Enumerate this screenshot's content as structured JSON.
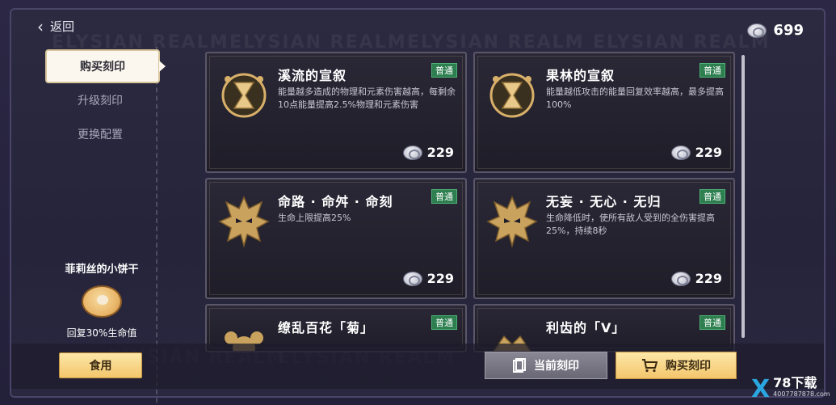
{
  "header": {
    "back_label": "返回",
    "currency_amount": "699",
    "watermark_text": "ELYSIAN REALM"
  },
  "sidebar": {
    "items": [
      {
        "label": "购买刻印",
        "active": true
      },
      {
        "label": "升级刻印",
        "active": false
      },
      {
        "label": "更换配置",
        "active": false
      }
    ],
    "item": {
      "name": "菲莉丝的小饼干",
      "desc": "回复30%生命值",
      "eat_label": "食用"
    }
  },
  "cards": [
    {
      "title": "溪流的宣叙",
      "badge": "普通",
      "desc": "能量越多造成的物理和元素伤害越高，每剩余10点能量提高2.5%物理和元素伤害",
      "price": "229",
      "emblem": "hourglass-emblem"
    },
    {
      "title": "果林的宣叙",
      "badge": "普通",
      "desc": "能量越低攻击的能量回复效率越高，最多提高100%",
      "price": "229",
      "emblem": "hourglass-emblem"
    },
    {
      "title": "命路 · 命舛 · 命刻",
      "badge": "普通",
      "desc": "生命上限提高25%",
      "price": "229",
      "emblem": "demon-mask-emblem"
    },
    {
      "title": "无妄 · 无心 · 无归",
      "badge": "普通",
      "desc": "生命降低时，使所有敌人受到的全伤害提高25%，持续8秒",
      "price": "229",
      "emblem": "demon-mask-emblem"
    },
    {
      "title": "缭乱百花「菊」",
      "badge": "普通",
      "desc": "",
      "price": "",
      "emblem": "flower-emblem"
    },
    {
      "title": "利齿的「V」",
      "badge": "普通",
      "desc": "",
      "price": "",
      "emblem": "beast-emblem"
    }
  ],
  "footer": {
    "current_label": "当前刻印",
    "buy_label": "购买刻印"
  },
  "logo": {
    "main": "78下载",
    "sub": "4007787878.com"
  },
  "colors": {
    "accent_gold": "#f3c66c",
    "badge_green": "#2d7f50"
  }
}
